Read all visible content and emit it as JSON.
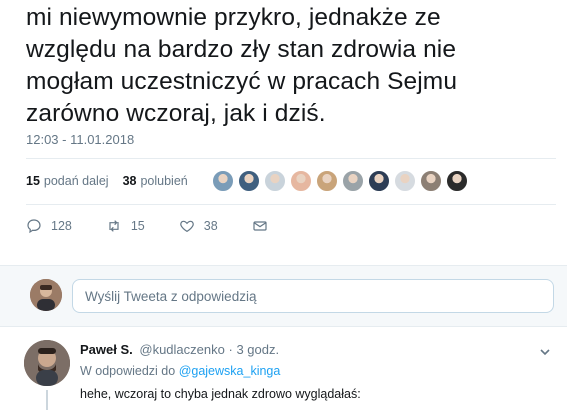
{
  "tweet": {
    "lines": [
      "mi niewymownie przykro, jednakże ze",
      "względu na bardzo zły stan zdrowia nie",
      "mogłam uczestniczyć w pracach Sejmu",
      "zarówno wczoraj, jak i dziś."
    ],
    "timestamp": "12:03 - 11.01.2018"
  },
  "stats": {
    "retweets_count": "15",
    "retweets_label": "podań dalej",
    "likes_count": "38",
    "likes_label": "polubień"
  },
  "liker_avatar_colors": [
    "#7a9cb8",
    "#3f5f7f",
    "#c9d3db",
    "#e6b7a0",
    "#c9a47a",
    "#9aa3a8",
    "#2d3d55",
    "#d6dbe0",
    "#8c7f74",
    "#2b2b2b"
  ],
  "actions": {
    "reply_count": "128",
    "retweet_count": "15",
    "like_count": "38"
  },
  "reply_box": {
    "placeholder": "Wyślij Tweeta z odpowiedzią"
  },
  "reply_tweet": {
    "name": "Paweł S.",
    "handle": "@kudlaczenko",
    "separator": "·",
    "time": "3 godz.",
    "in_reply_prefix": "W odpowiedzi do",
    "in_reply_handle": "@gajewska_kinga",
    "text": "hehe, wczoraj to chyba jednak zdrowo wyglądałaś:"
  },
  "colors": {
    "accent": "#1da1f2",
    "muted": "#657786",
    "text": "#14171a"
  }
}
